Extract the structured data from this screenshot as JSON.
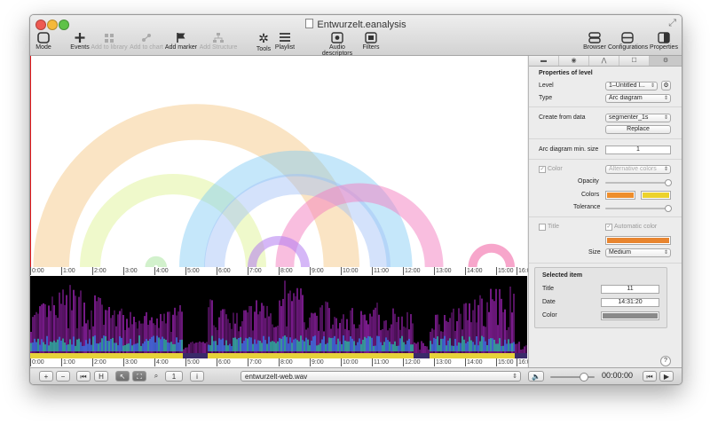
{
  "window": {
    "title": "Entwurzelt.eanalysis",
    "fullscreen_glyph": "⤢"
  },
  "toolbar": {
    "mode": "Mode",
    "events": "Events",
    "add_to_library": "Add to library",
    "add_to_chart": "Add to chart",
    "add_marker": "Add marker",
    "add_structure": "Add Structure",
    "tools": "Tools",
    "playlist": "Playlist",
    "audio_descriptors": "Audio descriptors",
    "filters": "Filters",
    "browser": "Browser",
    "configurations": "Configurations",
    "properties": "Properties"
  },
  "timeline": {
    "ticks": [
      "0:00",
      "1:00",
      "2:00",
      "3:00",
      "4:00",
      "5:00",
      "6:00",
      "7:00",
      "8:00",
      "9:00",
      "10:00",
      "11:00",
      "12:00",
      "13:00",
      "14:00",
      "15:00",
      "16:0"
    ]
  },
  "arcs": [
    {
      "color": "#f5c37d",
      "start_min": 0.1,
      "end_min": 10.6,
      "opacity": 0.45
    },
    {
      "color": "#d8ef7e",
      "start_min": 1.6,
      "end_min": 7.6,
      "opacity": 0.4
    },
    {
      "color": "#7ec9f3",
      "start_min": 4.8,
      "end_min": 12.3,
      "opacity": 0.45
    },
    {
      "color": "#9fbff7",
      "start_min": 5.6,
      "end_min": 11.6,
      "opacity": 0.45
    },
    {
      "color": "#f47ec0",
      "start_min": 7.9,
      "end_min": 13.3,
      "opacity": 0.5
    },
    {
      "color": "#b37cf0",
      "start_min": 7.0,
      "end_min": 9.0,
      "opacity": 0.55
    },
    {
      "color": "#a6e39a",
      "start_min": 3.7,
      "end_min": 4.4,
      "opacity": 0.5
    },
    {
      "color": "#f26ba8",
      "start_min": 14.1,
      "end_min": 15.6,
      "opacity": 0.6
    }
  ],
  "bottombar": {
    "add": "+",
    "remove": "−",
    "rewind": "⏮",
    "zoom_value": "1",
    "info": "i",
    "file": "entwurzelt-web.wav",
    "volume_icon": "🔈",
    "time": "00:00:00",
    "volume_level": 0.8
  },
  "panel": {
    "tabs": [
      "▬",
      "◉",
      "⋀",
      "☐",
      "⚙"
    ],
    "heading": "Properties of level",
    "level_label": "Level",
    "level_value": "1–Untitled l...",
    "type_label": "Type",
    "type_value": "Arc diagram",
    "create_label": "Create from data",
    "create_value": "segmenter_1s",
    "replace": "Replace",
    "min_size_label": "Arc diagram min. size",
    "min_size_value": "1",
    "color_label": "Color",
    "color_mode": "Alternative colors",
    "opacity_label": "Opacity",
    "colors_label": "Colors",
    "color_a": "#ee8e2c",
    "color_b": "#ecd22c",
    "tolerance_label": "Tolerance",
    "title_label": "Title",
    "auto_color_label": "Automatic color",
    "title_color": "#e8852f",
    "size_label": "Size",
    "size_value": "Medium",
    "selected_heading": "Selected item",
    "sel_title_label": "Title",
    "sel_title_value": "11",
    "sel_date_label": "Date",
    "sel_date_value": "14:31:20",
    "sel_color_label": "Color",
    "sel_color": "#8a8a8a",
    "help": "?"
  }
}
